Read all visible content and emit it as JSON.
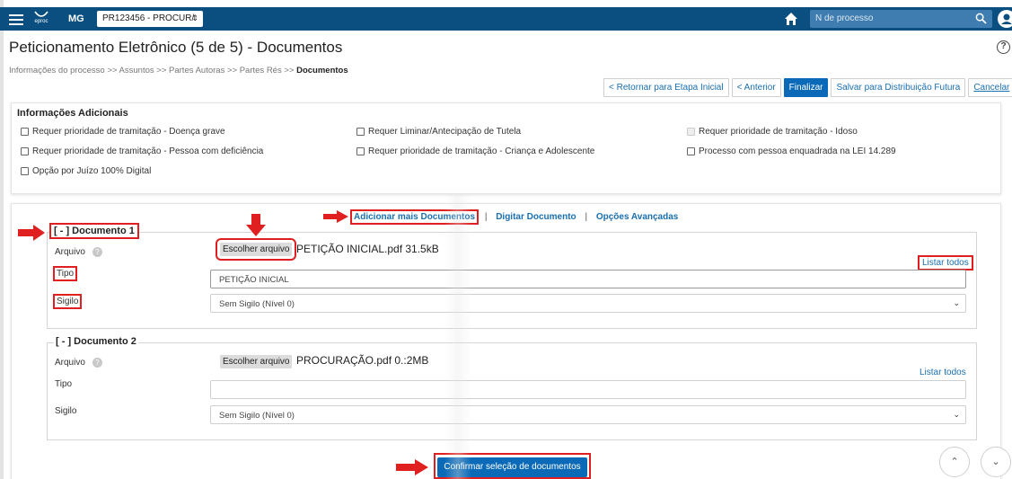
{
  "topbar": {
    "logo_text": "eproc",
    "uf": "MG",
    "process_select": "PR123456 - PROCUR/",
    "search_placeholder": "N de processo"
  },
  "page": {
    "title": "Peticionamento Eletrônico (5 de 5) - Documentos",
    "help": "?",
    "breadcrumb": {
      "items": [
        "Informações do processo",
        "Assuntos",
        "Partes Autoras",
        "Partes Rés"
      ],
      "separator": ">>",
      "current": "Documentos"
    }
  },
  "actions": {
    "back_initial": "< Retornar para Etapa Inicial",
    "previous": "< Anterior",
    "finish": "Finalizar",
    "save_future": "Salvar para Distribuição Futura",
    "cancel": "Cancelar"
  },
  "info": {
    "legend": "Informações Adicionais",
    "options": [
      "Requer prioridade de tramitação - Doença grave",
      "Requer Liminar/Antecipação de Tutela",
      "Requer prioridade de tramitação - Idoso",
      "Requer prioridade de tramitação - Pessoa com deficiência",
      "Requer prioridade de tramitação - Criança e Adolescente",
      "Processo com pessoa enquadrada na LEI 14.289",
      "Opção por Juízo 100% Digital"
    ]
  },
  "docs_links": {
    "add_more": "Adicionar mais Documentos",
    "sep": "|",
    "type_doc": "Digitar Documento",
    "advanced": "Opções Avançadas"
  },
  "documents": [
    {
      "legend": "[ - ] Documento 1",
      "file_label": "Arquivo",
      "choose_file": "Escolher arquivo",
      "file_name": "PETIÇÃO INICIAL.pdf 31.5kB",
      "list_all": "Listar todos",
      "type_label": "Tipo",
      "type_value": "PETIÇÃO INICIAL",
      "secrecy_label": "Sigilo",
      "secrecy_value": "Sem Sigilo (Nível 0)"
    },
    {
      "legend": "[ - ] Documento 2",
      "file_label": "Arquivo",
      "choose_file": "Escolher arquivo",
      "file_name": "PROCURAÇÃO.pdf 0.:2MB",
      "list_all": "Listar todos",
      "type_label": "Tipo",
      "type_value": "",
      "secrecy_label": "Sigilo",
      "secrecy_value": "Sem Sigilo (Nível 0)"
    }
  ],
  "confirm": "Confirmar seleção de documentos",
  "colors": {
    "topbar": "#0a4f7f",
    "primary": "#0a6ab8",
    "link": "#1a6fb0",
    "highlight": "#e02020"
  }
}
